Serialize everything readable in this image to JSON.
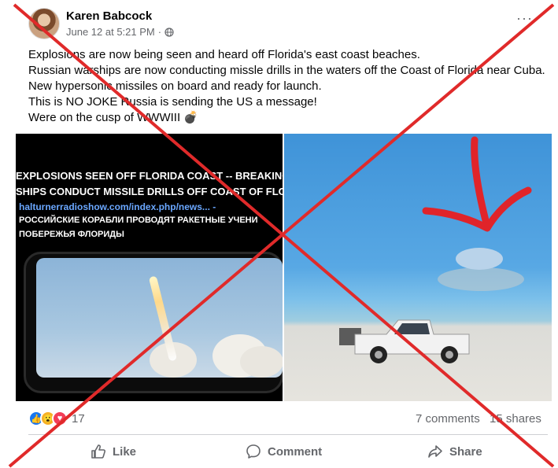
{
  "post": {
    "author": "Karen Babcock",
    "timestamp": "June 12 at 5:21 PM",
    "separator": "·",
    "audience_icon": "globe-icon",
    "more_label": "···",
    "text_lines": [
      "Explosions are now being seen and heard off Florida's east coast beaches.",
      "Russian warships are now conducting missle drills in the waters off the Coast of Florida near Cuba.",
      "New hypersonic missiles on board and ready for launch.",
      "This is NO JOKE Russia is sending the US a message!",
      "Were on the cusp of WWWIII 💣"
    ]
  },
  "left_image": {
    "line1": "EXPLOSIONS SEEN OFF FLORIDA COAST -- BREAKING N",
    "line2": "SHIPS CONDUCT MISSILE DRILLS OFF COAST OF FLORI",
    "line3": "halturnerradioshow.com/index.php/news... -",
    "line4": "РОССИЙСКИЕ КОРАБЛИ ПРОВОДЯТ РАКЕТНЫЕ УЧЕНИ",
    "line5": "ПОБЕРЕЖЬЯ ФЛОРИДЫ"
  },
  "footer": {
    "reaction_icons": [
      "like-icon",
      "wow-icon",
      "love-icon"
    ],
    "reaction_count": "17",
    "comments": "7 comments",
    "shares": "15 shares",
    "actions": {
      "like": "Like",
      "comment": "Comment",
      "share": "Share"
    }
  },
  "colors": {
    "overlay_x": "#e02a2a",
    "link_blue": "#1877f2",
    "secondary_text": "#65676b"
  }
}
